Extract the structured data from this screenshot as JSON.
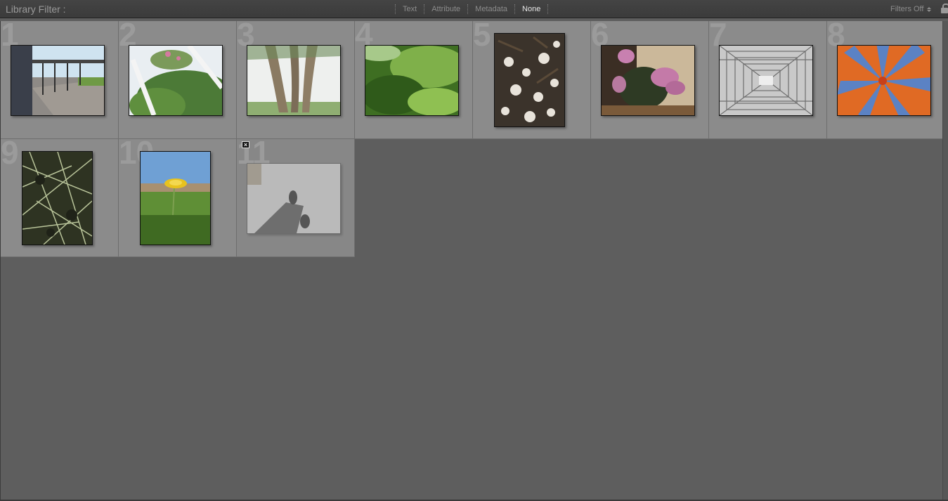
{
  "filter_bar": {
    "title": "Library Filter :",
    "modes": [
      {
        "label": "Text",
        "active": false
      },
      {
        "label": "Attribute",
        "active": false
      },
      {
        "label": "Metadata",
        "active": false
      },
      {
        "label": "None",
        "active": true
      }
    ],
    "filters_preset": "Filters Off",
    "lock_icon": "lock-icon"
  },
  "grid": {
    "cells": [
      {
        "number": "1",
        "subject": "covered walkway",
        "orientation": "landscape",
        "rejected": false
      },
      {
        "number": "2",
        "subject": "bush with pink flowers",
        "orientation": "landscape",
        "rejected": false
      },
      {
        "number": "3",
        "subject": "palm trunks",
        "orientation": "landscape",
        "rejected": false
      },
      {
        "number": "4",
        "subject": "green leaves close-up",
        "orientation": "landscape",
        "rejected": false
      },
      {
        "number": "5",
        "subject": "pebbles and mulch",
        "orientation": "portrait",
        "rejected": false
      },
      {
        "number": "6",
        "subject": "pink flowers",
        "orientation": "landscape",
        "rejected": false
      },
      {
        "number": "7",
        "subject": "wire grid",
        "orientation": "landscape",
        "rejected": false
      },
      {
        "number": "8",
        "subject": "blue pinwheel on orange",
        "orientation": "landscape",
        "rejected": false
      },
      {
        "number": "9",
        "subject": "pine needles",
        "orientation": "portrait",
        "rejected": false
      },
      {
        "number": "10",
        "subject": "dandelion in grass",
        "orientation": "portrait",
        "rejected": false
      },
      {
        "number": "11",
        "subject": "feet on white floor",
        "orientation": "landscape",
        "rejected": true
      }
    ],
    "reject_flag_icon": "reject-flag-icon"
  },
  "colors": {
    "background": "#5e5e5e",
    "cell": "#8b8b8b",
    "active_mode": "#e6e6e6",
    "inactive_mode": "#8c8c8c"
  }
}
